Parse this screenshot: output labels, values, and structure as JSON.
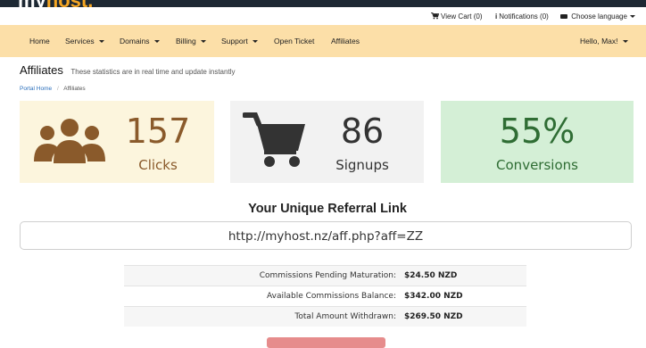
{
  "brand": {
    "logo_primary": "my",
    "logo_accent": "host."
  },
  "utility": {
    "cart_label": "View Cart (0)",
    "notifications_label": "Notifications (0)",
    "language_label": "Choose language"
  },
  "nav": {
    "home": "Home",
    "services": "Services",
    "domains": "Domains",
    "billing": "Billing",
    "support": "Support",
    "open_ticket": "Open Ticket",
    "affiliates": "Affiliates",
    "user_menu": "Hello, Max!"
  },
  "page": {
    "title": "Affiliates",
    "subtitle": "These statistics are in real time and update instantly"
  },
  "breadcrumb": {
    "home": "Portal Home",
    "current": "Affiliates"
  },
  "stats": {
    "clicks": {
      "value": "157",
      "label": "Clicks",
      "icon": "users-icon",
      "color": "#8a5a2b",
      "bg": "#fcf5dd"
    },
    "signups": {
      "value": "86",
      "label": "Signups",
      "icon": "cart-icon",
      "color": "#333333",
      "bg": "#f2f2f2"
    },
    "conversions": {
      "value": "55%",
      "label": "Conversions",
      "color": "#2f6d34",
      "bg": "#d4efd6"
    }
  },
  "referral": {
    "heading": "Your Unique Referral Link",
    "link": "http://myhost.nz/aff.php?aff=ZZ"
  },
  "commissions": [
    {
      "label": "Commissions Pending Maturation:",
      "value": "$24.50 NZD"
    },
    {
      "label": "Available Commissions Balance:",
      "value": "$342.00 NZD"
    },
    {
      "label": "Total Amount Withdrawn:",
      "value": "$269.50 NZD"
    }
  ],
  "colors": {
    "nav_bg": "#fcdfa8",
    "topbar_bg": "#1d2833",
    "accent": "#f5a623",
    "withdraw_button": "#e68c8c"
  }
}
